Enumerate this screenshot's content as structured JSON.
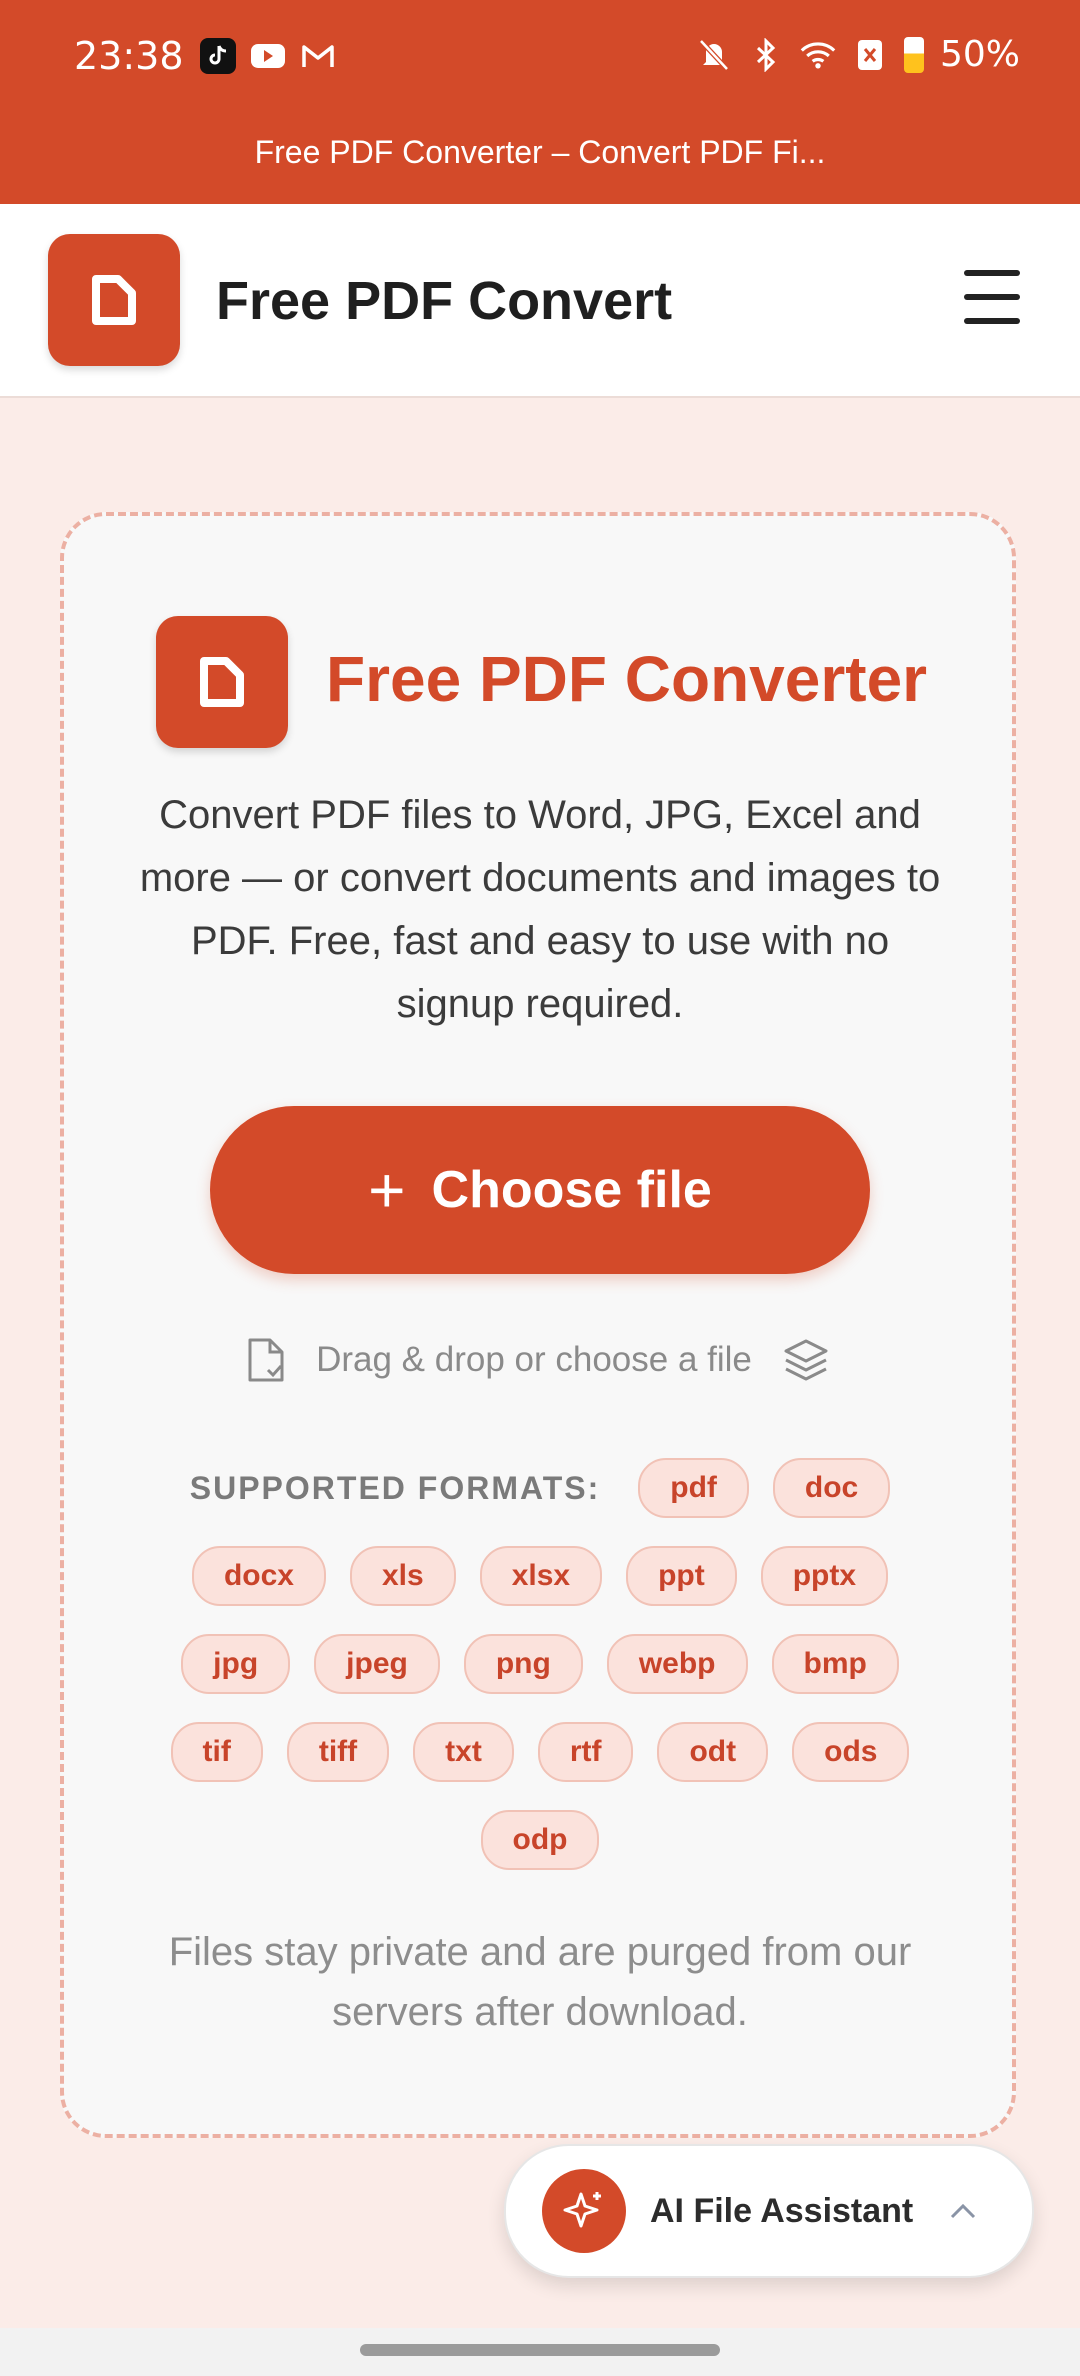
{
  "status_bar": {
    "time": "23:38",
    "apps": [
      "tiktok-icon",
      "youtube-icon",
      "gmail-icon"
    ],
    "system_icons": [
      "mute-icon",
      "bluetooth-icon",
      "wifi-icon",
      "sim-icon",
      "battery-icon"
    ],
    "battery": "50%",
    "battery_level": 0.5
  },
  "browser": {
    "page_title": "Free PDF Converter – Convert PDF Fi..."
  },
  "header": {
    "brand": "Free PDF Convert",
    "menu_icon": "hamburger-icon"
  },
  "hero": {
    "title": "Free PDF Converter",
    "description": "Convert PDF files to Word, JPG, Excel and more — or convert documents and images to PDF. Free, fast and easy to use with no signup required.",
    "choose_button": "Choose file",
    "drag_text": "Drag & drop or choose a file"
  },
  "formats": {
    "label": "SUPPORTED FORMATS:",
    "rows": [
      [
        "pdf",
        "doc"
      ],
      [
        "docx",
        "xls",
        "xlsx",
        "ppt",
        "pptx"
      ],
      [
        "jpg",
        "jpeg",
        "png",
        "webp",
        "bmp"
      ],
      [
        "tif",
        "tiff",
        "txt",
        "rtf",
        "odt",
        "ods"
      ],
      [
        "odp"
      ]
    ]
  },
  "privacy": "Files stay private and are purged from our servers after download.",
  "assistant": {
    "label": "AI File Assistant"
  },
  "colors": {
    "accent": "#d34a29",
    "background": "#fbece8",
    "chip_bg": "#fbe2dc"
  }
}
